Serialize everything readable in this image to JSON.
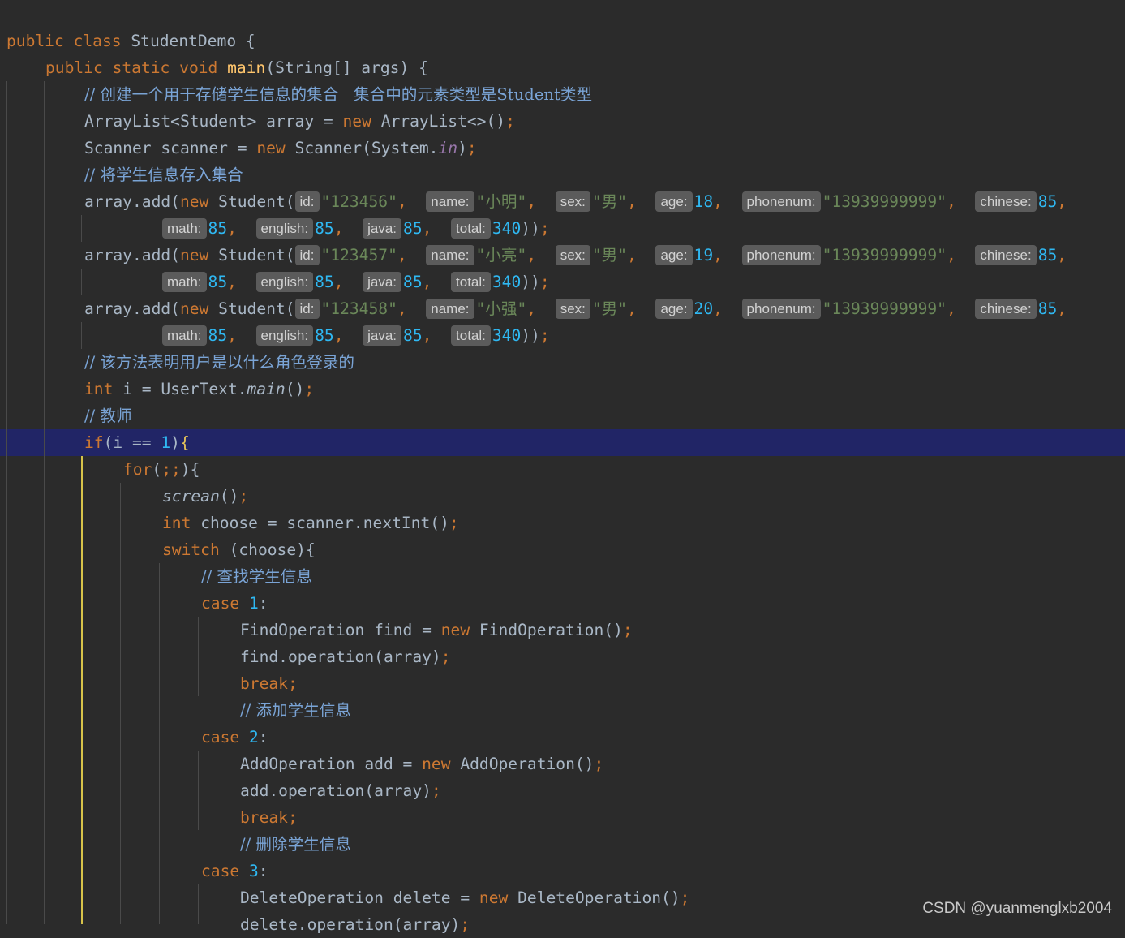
{
  "watermark": "CSDN @yuanmenglxb2004",
  "colors": {
    "background": "#2b2b2b",
    "current_line": "#212566",
    "keyword": "#cc7832",
    "string": "#6a8759",
    "number": "#2fb8f2",
    "comment": "#7aa4d6",
    "function": "#ffc66d",
    "hint_chip": "#5b5b5b"
  },
  "lines": [
    {
      "indent": 0,
      "tokens": [
        {
          "t": "public class ",
          "c": "kw"
        },
        {
          "t": "StudentDemo {",
          "c": "plain"
        }
      ]
    },
    {
      "indent": 1,
      "tokens": [
        {
          "t": "public static void ",
          "c": "kw"
        },
        {
          "t": "main",
          "c": "fn"
        },
        {
          "t": "(String[] args) {",
          "c": "plain"
        }
      ]
    },
    {
      "indent": 2,
      "tokens": [
        {
          "t": "// 创建一个用于存储学生信息的集合   集合中的元素类型是Student类型",
          "c": "cmt"
        }
      ]
    },
    {
      "indent": 2,
      "tokens": [
        {
          "t": "ArrayList<Student> array = ",
          "c": "plain"
        },
        {
          "t": "new ",
          "c": "kw"
        },
        {
          "t": "ArrayList<>()",
          "c": "plain"
        },
        {
          "t": ";",
          "c": "semi"
        }
      ]
    },
    {
      "indent": 2,
      "tokens": [
        {
          "t": "Scanner scanner = ",
          "c": "plain"
        },
        {
          "t": "new ",
          "c": "kw"
        },
        {
          "t": "Scanner(System.",
          "c": "plain"
        },
        {
          "t": "in",
          "c": "sf"
        },
        {
          "t": ")",
          "c": "plain"
        },
        {
          "t": ";",
          "c": "semi"
        }
      ]
    },
    {
      "indent": 2,
      "tokens": [
        {
          "t": "// 将学生信息存入集合",
          "c": "cmt"
        }
      ]
    },
    {
      "indent": 2,
      "tokens": [
        {
          "t": "array.add(",
          "c": "plain"
        },
        {
          "t": "new ",
          "c": "kw"
        },
        {
          "t": "Student(",
          "c": "plain"
        },
        {
          "h": "id:"
        },
        {
          "t": "\"123456\"",
          "c": "str"
        },
        {
          "t": ",  ",
          "c": "semi"
        },
        {
          "h": "name:"
        },
        {
          "t": "\"小明\"",
          "c": "str"
        },
        {
          "t": ",  ",
          "c": "semi"
        },
        {
          "h": "sex:"
        },
        {
          "t": "\"男\"",
          "c": "str"
        },
        {
          "t": ",  ",
          "c": "semi"
        },
        {
          "h": "age:"
        },
        {
          "t": "18",
          "c": "num"
        },
        {
          "t": ",  ",
          "c": "semi"
        },
        {
          "h": "phonenum:"
        },
        {
          "t": "\"13939999999\"",
          "c": "str"
        },
        {
          "t": ",  ",
          "c": "semi"
        },
        {
          "h": "chinese:"
        },
        {
          "t": "85",
          "c": "num"
        },
        {
          "t": ",",
          "c": "semi"
        }
      ]
    },
    {
      "indent": 4,
      "tokens": [
        {
          "h": "math:"
        },
        {
          "t": "85",
          "c": "num"
        },
        {
          "t": ",  ",
          "c": "semi"
        },
        {
          "h": "english:"
        },
        {
          "t": "85",
          "c": "num"
        },
        {
          "t": ",  ",
          "c": "semi"
        },
        {
          "h": "java:"
        },
        {
          "t": "85",
          "c": "num"
        },
        {
          "t": ",  ",
          "c": "semi"
        },
        {
          "h": "total:"
        },
        {
          "t": "340",
          "c": "num"
        },
        {
          "t": "))",
          "c": "plain"
        },
        {
          "t": ";",
          "c": "semi"
        }
      ]
    },
    {
      "indent": 2,
      "tokens": [
        {
          "t": "array.add(",
          "c": "plain"
        },
        {
          "t": "new ",
          "c": "kw"
        },
        {
          "t": "Student(",
          "c": "plain"
        },
        {
          "h": "id:"
        },
        {
          "t": "\"123457\"",
          "c": "str"
        },
        {
          "t": ",  ",
          "c": "semi"
        },
        {
          "h": "name:"
        },
        {
          "t": "\"小亮\"",
          "c": "str"
        },
        {
          "t": ",  ",
          "c": "semi"
        },
        {
          "h": "sex:"
        },
        {
          "t": "\"男\"",
          "c": "str"
        },
        {
          "t": ",  ",
          "c": "semi"
        },
        {
          "h": "age:"
        },
        {
          "t": "19",
          "c": "num"
        },
        {
          "t": ",  ",
          "c": "semi"
        },
        {
          "h": "phonenum:"
        },
        {
          "t": "\"13939999999\"",
          "c": "str"
        },
        {
          "t": ",  ",
          "c": "semi"
        },
        {
          "h": "chinese:"
        },
        {
          "t": "85",
          "c": "num"
        },
        {
          "t": ",",
          "c": "semi"
        }
      ]
    },
    {
      "indent": 4,
      "tokens": [
        {
          "h": "math:"
        },
        {
          "t": "85",
          "c": "num"
        },
        {
          "t": ",  ",
          "c": "semi"
        },
        {
          "h": "english:"
        },
        {
          "t": "85",
          "c": "num"
        },
        {
          "t": ",  ",
          "c": "semi"
        },
        {
          "h": "java:"
        },
        {
          "t": "85",
          "c": "num"
        },
        {
          "t": ",  ",
          "c": "semi"
        },
        {
          "h": "total:"
        },
        {
          "t": "340",
          "c": "num"
        },
        {
          "t": "))",
          "c": "plain"
        },
        {
          "t": ";",
          "c": "semi"
        }
      ]
    },
    {
      "indent": 2,
      "tokens": [
        {
          "t": "array.add(",
          "c": "plain"
        },
        {
          "t": "new ",
          "c": "kw"
        },
        {
          "t": "Student(",
          "c": "plain"
        },
        {
          "h": "id:"
        },
        {
          "t": "\"123458\"",
          "c": "str"
        },
        {
          "t": ",  ",
          "c": "semi"
        },
        {
          "h": "name:"
        },
        {
          "t": "\"小强\"",
          "c": "str"
        },
        {
          "t": ",  ",
          "c": "semi"
        },
        {
          "h": "sex:"
        },
        {
          "t": "\"男\"",
          "c": "str"
        },
        {
          "t": ",  ",
          "c": "semi"
        },
        {
          "h": "age:"
        },
        {
          "t": "20",
          "c": "num"
        },
        {
          "t": ",  ",
          "c": "semi"
        },
        {
          "h": "phonenum:"
        },
        {
          "t": "\"13939999999\"",
          "c": "str"
        },
        {
          "t": ",  ",
          "c": "semi"
        },
        {
          "h": "chinese:"
        },
        {
          "t": "85",
          "c": "num"
        },
        {
          "t": ",",
          "c": "semi"
        }
      ]
    },
    {
      "indent": 4,
      "tokens": [
        {
          "h": "math:"
        },
        {
          "t": "85",
          "c": "num"
        },
        {
          "t": ",  ",
          "c": "semi"
        },
        {
          "h": "english:"
        },
        {
          "t": "85",
          "c": "num"
        },
        {
          "t": ",  ",
          "c": "semi"
        },
        {
          "h": "java:"
        },
        {
          "t": "85",
          "c": "num"
        },
        {
          "t": ",  ",
          "c": "semi"
        },
        {
          "h": "total:"
        },
        {
          "t": "340",
          "c": "num"
        },
        {
          "t": "))",
          "c": "plain"
        },
        {
          "t": ";",
          "c": "semi"
        }
      ]
    },
    {
      "indent": 2,
      "tokens": [
        {
          "t": "// 该方法表明用户是以什么角色登录的",
          "c": "cmt"
        }
      ]
    },
    {
      "indent": 2,
      "tokens": [
        {
          "t": "int ",
          "c": "kw"
        },
        {
          "t": "i = UserText.",
          "c": "plain"
        },
        {
          "t": "main",
          "c": "it"
        },
        {
          "t": "()",
          "c": "plain"
        },
        {
          "t": ";",
          "c": "semi"
        }
      ]
    },
    {
      "indent": 2,
      "tokens": [
        {
          "t": "// 教师",
          "c": "cmt"
        }
      ]
    },
    {
      "indent": 2,
      "active": true,
      "tokens": [
        {
          "t": "if",
          "c": "kw"
        },
        {
          "t": "(i == ",
          "c": "plain"
        },
        {
          "t": "1",
          "c": "num"
        },
        {
          "t": ")",
          "c": "plain"
        },
        {
          "t": "{",
          "c": "brace"
        }
      ]
    },
    {
      "indent": 3,
      "tokens": [
        {
          "t": "for",
          "c": "kw"
        },
        {
          "t": "(",
          "c": "plain"
        },
        {
          "t": ";;",
          "c": "semi"
        },
        {
          "t": "){",
          "c": "plain"
        }
      ]
    },
    {
      "indent": 4,
      "tokens": [
        {
          "t": "screan",
          "c": "it"
        },
        {
          "t": "()",
          "c": "plain"
        },
        {
          "t": ";",
          "c": "semi"
        }
      ]
    },
    {
      "indent": 4,
      "tokens": [
        {
          "t": "int ",
          "c": "kw"
        },
        {
          "t": "choose = scanner.nextInt()",
          "c": "plain"
        },
        {
          "t": ";",
          "c": "semi"
        }
      ]
    },
    {
      "indent": 4,
      "tokens": [
        {
          "t": "switch ",
          "c": "kw"
        },
        {
          "t": "(choose){",
          "c": "plain"
        }
      ]
    },
    {
      "indent": 5,
      "tokens": [
        {
          "t": "// 查找学生信息",
          "c": "cmt"
        }
      ]
    },
    {
      "indent": 5,
      "tokens": [
        {
          "t": "case ",
          "c": "kw"
        },
        {
          "t": "1",
          "c": "num"
        },
        {
          "t": ":",
          "c": "plain"
        }
      ]
    },
    {
      "indent": 6,
      "tokens": [
        {
          "t": "FindOperation find = ",
          "c": "plain"
        },
        {
          "t": "new ",
          "c": "kw"
        },
        {
          "t": "FindOperation()",
          "c": "plain"
        },
        {
          "t": ";",
          "c": "semi"
        }
      ]
    },
    {
      "indent": 6,
      "tokens": [
        {
          "t": "find.operation(array)",
          "c": "plain"
        },
        {
          "t": ";",
          "c": "semi"
        }
      ]
    },
    {
      "indent": 6,
      "tokens": [
        {
          "t": "break",
          "c": "kw"
        },
        {
          "t": ";",
          "c": "semi"
        }
      ]
    },
    {
      "indent": 6,
      "tokens": [
        {
          "t": "// 添加学生信息",
          "c": "cmt"
        }
      ]
    },
    {
      "indent": 5,
      "tokens": [
        {
          "t": "case ",
          "c": "kw"
        },
        {
          "t": "2",
          "c": "num"
        },
        {
          "t": ":",
          "c": "plain"
        }
      ]
    },
    {
      "indent": 6,
      "tokens": [
        {
          "t": "AddOperation add = ",
          "c": "plain"
        },
        {
          "t": "new ",
          "c": "kw"
        },
        {
          "t": "AddOperation()",
          "c": "plain"
        },
        {
          "t": ";",
          "c": "semi"
        }
      ]
    },
    {
      "indent": 6,
      "tokens": [
        {
          "t": "add.operation(array)",
          "c": "plain"
        },
        {
          "t": ";",
          "c": "semi"
        }
      ]
    },
    {
      "indent": 6,
      "tokens": [
        {
          "t": "break",
          "c": "kw"
        },
        {
          "t": ";",
          "c": "semi"
        }
      ]
    },
    {
      "indent": 6,
      "tokens": [
        {
          "t": "// 删除学生信息",
          "c": "cmt"
        }
      ]
    },
    {
      "indent": 5,
      "tokens": [
        {
          "t": "case ",
          "c": "kw"
        },
        {
          "t": "3",
          "c": "num"
        },
        {
          "t": ":",
          "c": "plain"
        }
      ]
    },
    {
      "indent": 6,
      "tokens": [
        {
          "t": "DeleteOperation delete = ",
          "c": "plain"
        },
        {
          "t": "new ",
          "c": "kw"
        },
        {
          "t": "DeleteOperation()",
          "c": "plain"
        },
        {
          "t": ";",
          "c": "semi"
        }
      ]
    },
    {
      "indent": 6,
      "tokens": [
        {
          "t": "delete.operation(array)",
          "c": "plain"
        },
        {
          "t": ";",
          "c": "semi"
        }
      ]
    }
  ]
}
